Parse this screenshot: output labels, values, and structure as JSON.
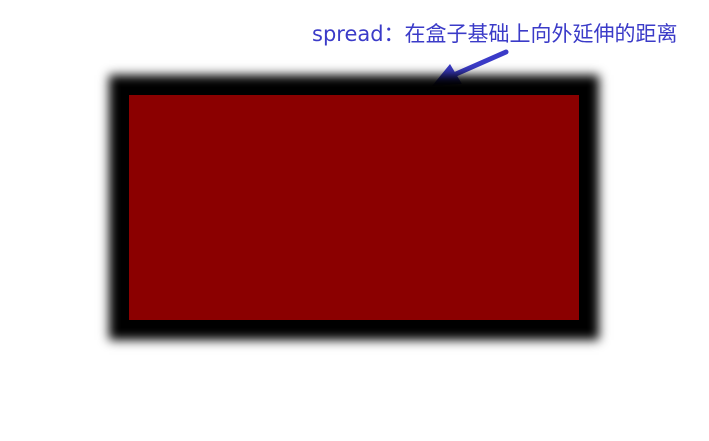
{
  "annotation": {
    "text": "spread：在盒子基础上向外延伸的距离",
    "color": "#3b3bc8"
  },
  "box": {
    "fill_color": "#8b0000",
    "shadow_color": "#000000"
  },
  "icons": {
    "arrow": "arrow-icon"
  }
}
